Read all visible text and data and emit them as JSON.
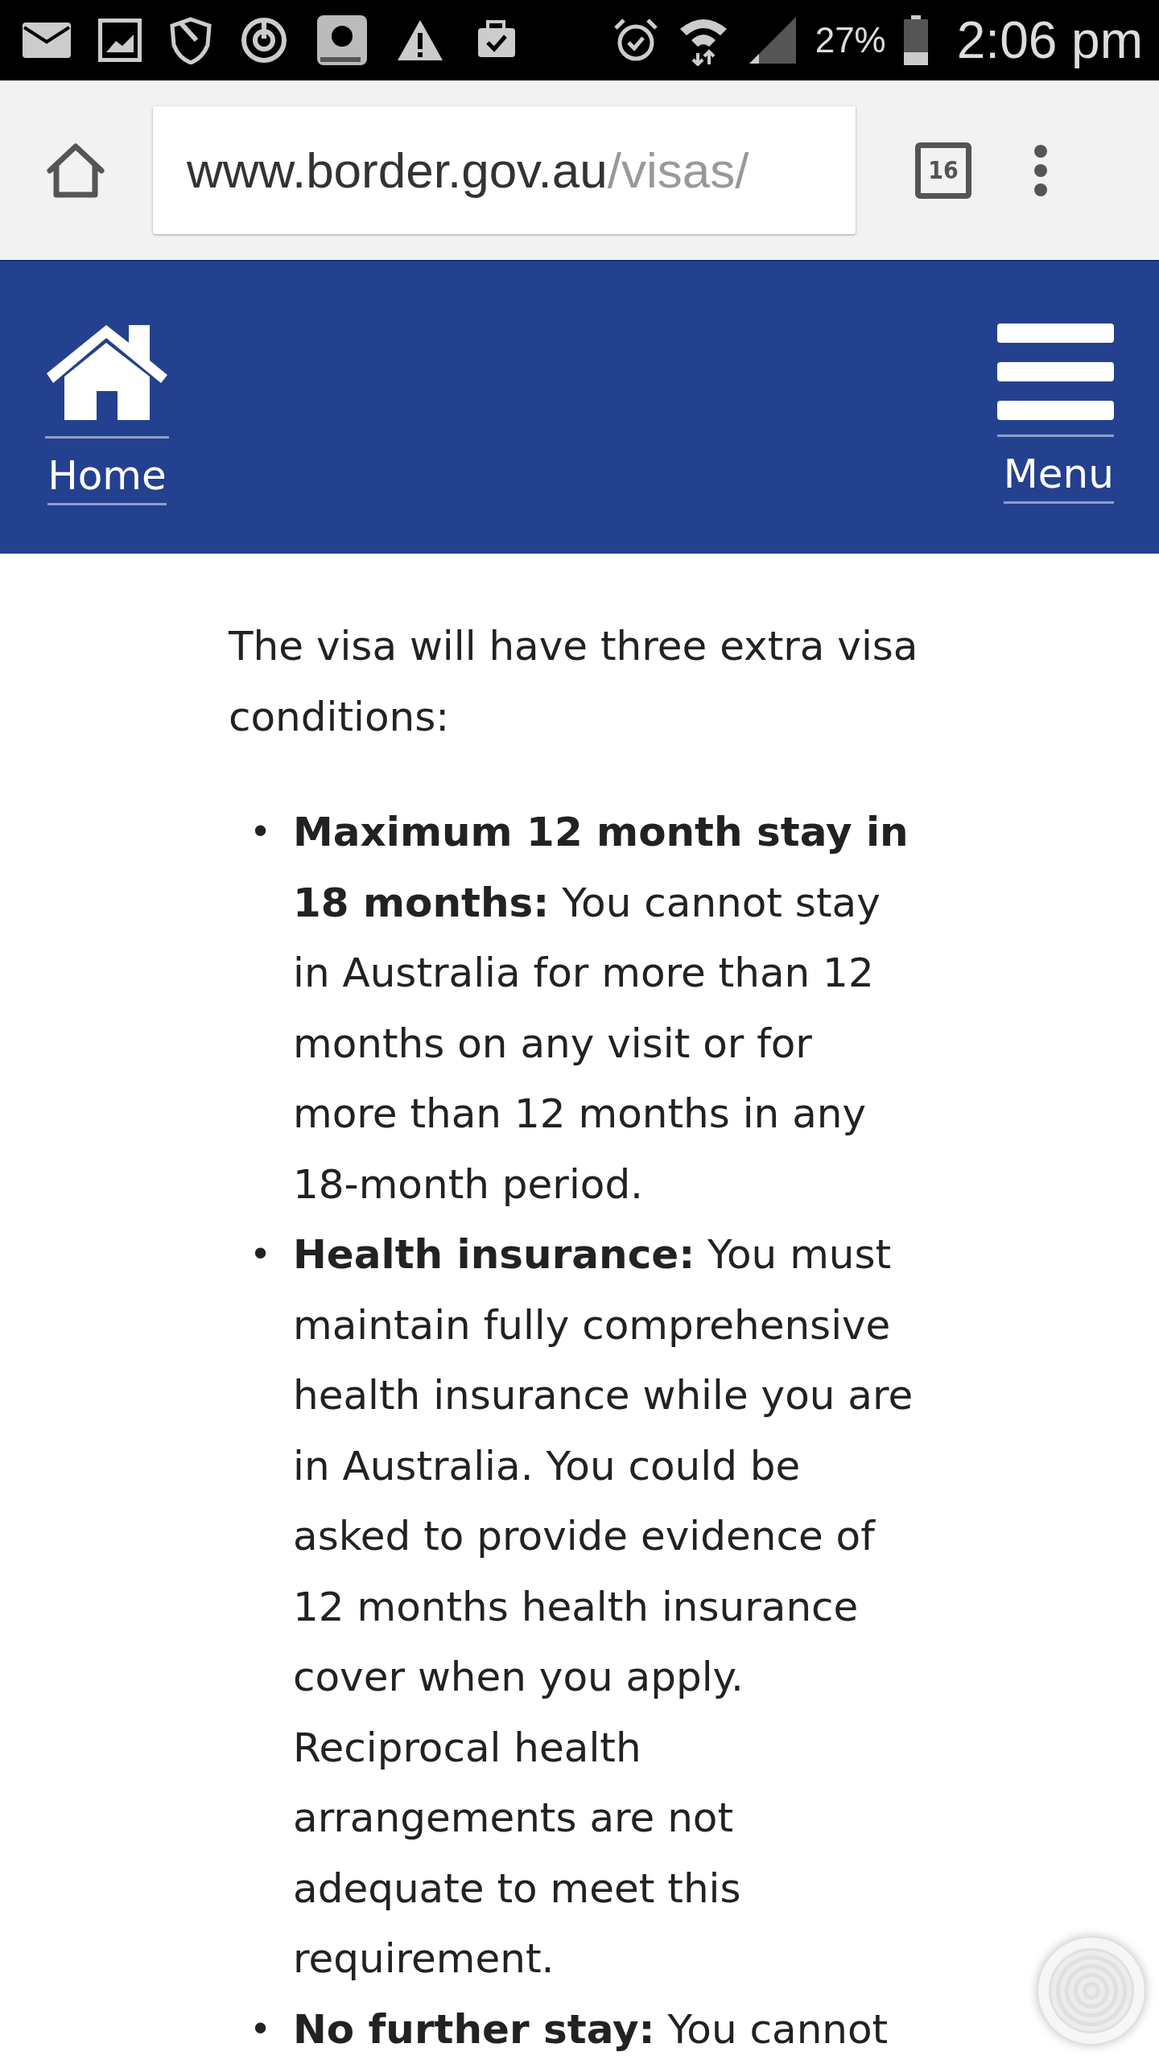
{
  "status_bar": {
    "battery": "27%",
    "time": "2:06 pm"
  },
  "browser": {
    "url_host": "www.border.gov.au",
    "url_path": "/visas/",
    "tab_count": "16"
  },
  "header": {
    "home_label": "Home",
    "menu_label": "Menu"
  },
  "content": {
    "intro": "The visa will have three extra visa conditions:",
    "conditions": [
      {
        "marker": "•",
        "text": "**Maximum 12 month stay in 18 months:** You cannot stay in Australia for more than 12 months on any visit or for more than 12 months in any 18-month period."
      },
      {
        "marker": "•",
        "text": "**Health insurance:** You must maintain fully comprehensive health insurance while you are in Australia. You could be asked to provide evidence of 12 months health insurance cover when you apply. Reciprocal health arrangements are not adequate to meet this requirement."
      },
      {
        "marker": "•",
        "text": "**No further stay:** You cannot"
      }
    ]
  }
}
